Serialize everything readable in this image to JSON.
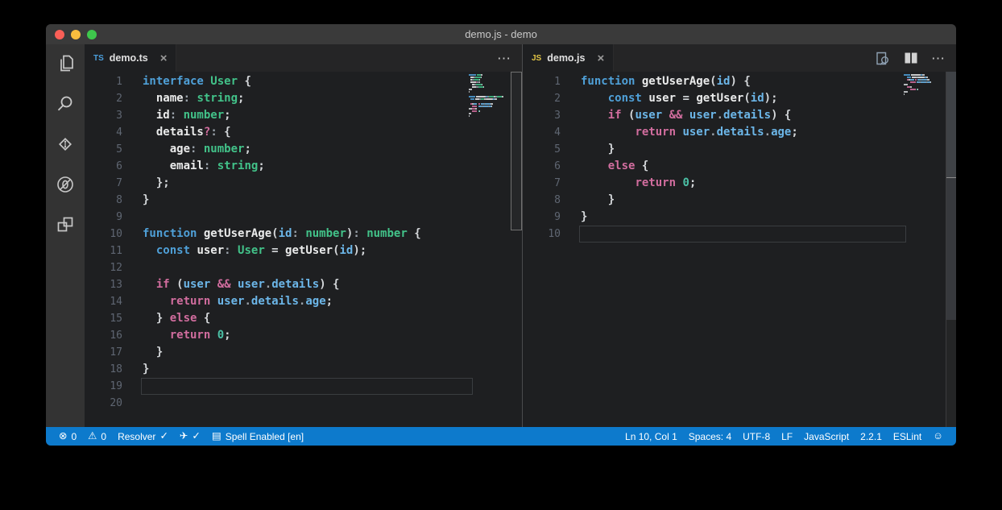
{
  "window": {
    "title": "demo.js - demo"
  },
  "colors": {
    "kw": "#4fa0d8",
    "ctl": "#d16d9e",
    "ty": "#42c289",
    "num": "#4bc0a5",
    "prop": "#6cb6e8",
    "id": "#eaebeb",
    "pl": "#d4d7da",
    "pu": "#9aa2aa",
    "statusbar": "#0d7acc",
    "ts_badge": "#4b9fdd",
    "js_badge": "#e2c545"
  },
  "editors": {
    "left": {
      "tab": {
        "badge": "TS",
        "title": "demo.ts",
        "close": "×"
      },
      "current_line": 19,
      "lines": [
        [
          [
            "kw",
            "interface"
          ],
          [
            "pl",
            " "
          ],
          [
            "ty",
            "User"
          ],
          [
            "pl",
            " {"
          ]
        ],
        [
          [
            "pl",
            "  "
          ],
          [
            "id",
            "name"
          ],
          [
            "pu",
            ": "
          ],
          [
            "ty",
            "string"
          ],
          [
            "pl",
            ";"
          ]
        ],
        [
          [
            "pl",
            "  "
          ],
          [
            "id",
            "id"
          ],
          [
            "pu",
            ": "
          ],
          [
            "ty",
            "number"
          ],
          [
            "pl",
            ";"
          ]
        ],
        [
          [
            "pl",
            "  "
          ],
          [
            "id",
            "details"
          ],
          [
            "ctl",
            "?"
          ],
          [
            "pu",
            ": "
          ],
          [
            "pl",
            "{"
          ]
        ],
        [
          [
            "pl",
            "    "
          ],
          [
            "id",
            "age"
          ],
          [
            "pu",
            ": "
          ],
          [
            "ty",
            "number"
          ],
          [
            "pl",
            ";"
          ]
        ],
        [
          [
            "pl",
            "    "
          ],
          [
            "id",
            "email"
          ],
          [
            "pu",
            ": "
          ],
          [
            "ty",
            "string"
          ],
          [
            "pl",
            ";"
          ]
        ],
        [
          [
            "pl",
            "  };"
          ]
        ],
        [
          [
            "pl",
            "}"
          ]
        ],
        [],
        [
          [
            "kw",
            "function"
          ],
          [
            "pl",
            " "
          ],
          [
            "id",
            "getUserAge"
          ],
          [
            "pl",
            "("
          ],
          [
            "prop",
            "id"
          ],
          [
            "pu",
            ": "
          ],
          [
            "ty",
            "number"
          ],
          [
            "pl",
            ")"
          ],
          [
            "pu",
            ": "
          ],
          [
            "ty",
            "number"
          ],
          [
            "pl",
            " {"
          ]
        ],
        [
          [
            "pl",
            "  "
          ],
          [
            "kw",
            "const"
          ],
          [
            "pl",
            " "
          ],
          [
            "id",
            "user"
          ],
          [
            "pu",
            ": "
          ],
          [
            "ty",
            "User"
          ],
          [
            "pl",
            " = "
          ],
          [
            "id",
            "getUser"
          ],
          [
            "pl",
            "("
          ],
          [
            "prop",
            "id"
          ],
          [
            "pl",
            ");"
          ]
        ],
        [],
        [
          [
            "pl",
            "  "
          ],
          [
            "ctl",
            "if"
          ],
          [
            "pl",
            " ("
          ],
          [
            "prop",
            "user"
          ],
          [
            "pl",
            " "
          ],
          [
            "ctl",
            "&&"
          ],
          [
            "pl",
            " "
          ],
          [
            "prop",
            "user"
          ],
          [
            "pu",
            "."
          ],
          [
            "prop",
            "details"
          ],
          [
            "pl",
            ") {"
          ]
        ],
        [
          [
            "pl",
            "    "
          ],
          [
            "ctl",
            "return"
          ],
          [
            "pl",
            " "
          ],
          [
            "prop",
            "user"
          ],
          [
            "pu",
            "."
          ],
          [
            "prop",
            "details"
          ],
          [
            "pu",
            "."
          ],
          [
            "prop",
            "age"
          ],
          [
            "pl",
            ";"
          ]
        ],
        [
          [
            "pl",
            "  } "
          ],
          [
            "ctl",
            "else"
          ],
          [
            "pl",
            " {"
          ]
        ],
        [
          [
            "pl",
            "    "
          ],
          [
            "ctl",
            "return"
          ],
          [
            "pl",
            " "
          ],
          [
            "num",
            "0"
          ],
          [
            "pl",
            ";"
          ]
        ],
        [
          [
            "pl",
            "  }"
          ]
        ],
        [
          [
            "pl",
            "}"
          ]
        ],
        [],
        []
      ]
    },
    "right": {
      "tab": {
        "badge": "JS",
        "title": "demo.js",
        "close": "×"
      },
      "current_line": 10,
      "lines": [
        [
          [
            "kw",
            "function"
          ],
          [
            "pl",
            " "
          ],
          [
            "id",
            "getUserAge"
          ],
          [
            "pl",
            "("
          ],
          [
            "prop",
            "id"
          ],
          [
            "pl",
            ") {"
          ]
        ],
        [
          [
            "pl",
            "    "
          ],
          [
            "kw",
            "const"
          ],
          [
            "pl",
            " "
          ],
          [
            "id",
            "user"
          ],
          [
            "pl",
            " = "
          ],
          [
            "id",
            "getUser"
          ],
          [
            "pl",
            "("
          ],
          [
            "prop",
            "id"
          ],
          [
            "pl",
            ");"
          ]
        ],
        [
          [
            "pl",
            "    "
          ],
          [
            "ctl",
            "if"
          ],
          [
            "pl",
            " ("
          ],
          [
            "prop",
            "user"
          ],
          [
            "pl",
            " "
          ],
          [
            "ctl",
            "&&"
          ],
          [
            "pl",
            " "
          ],
          [
            "prop",
            "user"
          ],
          [
            "pu",
            "."
          ],
          [
            "prop",
            "details"
          ],
          [
            "pl",
            ") {"
          ]
        ],
        [
          [
            "pl",
            "        "
          ],
          [
            "ctl",
            "return"
          ],
          [
            "pl",
            " "
          ],
          [
            "prop",
            "user"
          ],
          [
            "pu",
            "."
          ],
          [
            "prop",
            "details"
          ],
          [
            "pu",
            "."
          ],
          [
            "prop",
            "age"
          ],
          [
            "pl",
            ";"
          ]
        ],
        [
          [
            "pl",
            "    }"
          ]
        ],
        [
          [
            "pl",
            "    "
          ],
          [
            "ctl",
            "else"
          ],
          [
            "pl",
            " {"
          ]
        ],
        [
          [
            "pl",
            "        "
          ],
          [
            "ctl",
            "return"
          ],
          [
            "pl",
            " "
          ],
          [
            "num",
            "0"
          ],
          [
            "pl",
            ";"
          ]
        ],
        [
          [
            "pl",
            "    }"
          ]
        ],
        [
          [
            "pl",
            "}"
          ]
        ],
        []
      ]
    }
  },
  "status_bar": {
    "left": [
      {
        "name": "errors-status",
        "icons": [
          "error-icon"
        ],
        "text": "0"
      },
      {
        "name": "warnings-status",
        "icons": [
          "warning-icon"
        ],
        "text": "0"
      },
      {
        "name": "resolver-status",
        "text": "Resolver",
        "icons_after": [
          "check-icon"
        ]
      },
      {
        "name": "formatter-status",
        "icons": [
          "plane-icon"
        ],
        "icons_after": [
          "check-icon"
        ]
      },
      {
        "name": "spell-status",
        "icons": [
          "book-icon"
        ],
        "text": "Spell Enabled [en]"
      }
    ],
    "right": [
      {
        "name": "cursor-position",
        "text": "Ln 10, Col 1"
      },
      {
        "name": "indentation",
        "text": "Spaces: 4"
      },
      {
        "name": "encoding",
        "text": "UTF-8"
      },
      {
        "name": "eol",
        "text": "LF"
      },
      {
        "name": "language-mode",
        "text": "JavaScript"
      },
      {
        "name": "version",
        "text": "2.2.1"
      },
      {
        "name": "eslint-status",
        "text": "ESLint"
      },
      {
        "name": "feedback",
        "icons": [
          "smiley-icon"
        ]
      }
    ]
  }
}
